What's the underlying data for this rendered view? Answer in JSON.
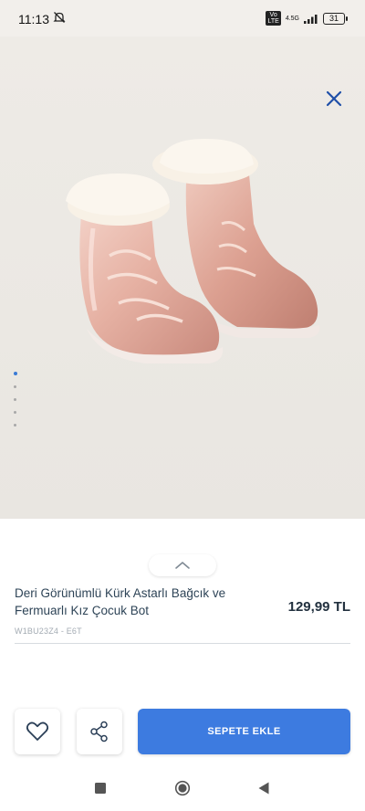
{
  "status_bar": {
    "time": "11:13",
    "network_badge": "Vo\nLTE",
    "network_type": "4.5G",
    "battery": "31"
  },
  "gallery": {
    "image_icon": "pink-ankle-boots-photo",
    "dot_count": 5,
    "active_dot": 0,
    "close_icon": "close-x-icon"
  },
  "product": {
    "title": "Deri Görünümlü Kürk Astarlı Bağcık ve Fermuarlı Kız Çocuk Bot",
    "price": "129,99 TL",
    "code": "W1BU23Z4 - E6T"
  },
  "actions": {
    "favorite_icon": "heart-icon",
    "share_icon": "share-icon",
    "add_to_cart_label": "SEPETE EKLE"
  },
  "colors": {
    "accent": "#3d7be0",
    "close_icon": "#1f4fa8",
    "text": "#2e4457"
  },
  "nav_bar": {
    "items": [
      "recent-apps-square-icon",
      "home-circle-icon",
      "back-triangle-icon"
    ]
  }
}
